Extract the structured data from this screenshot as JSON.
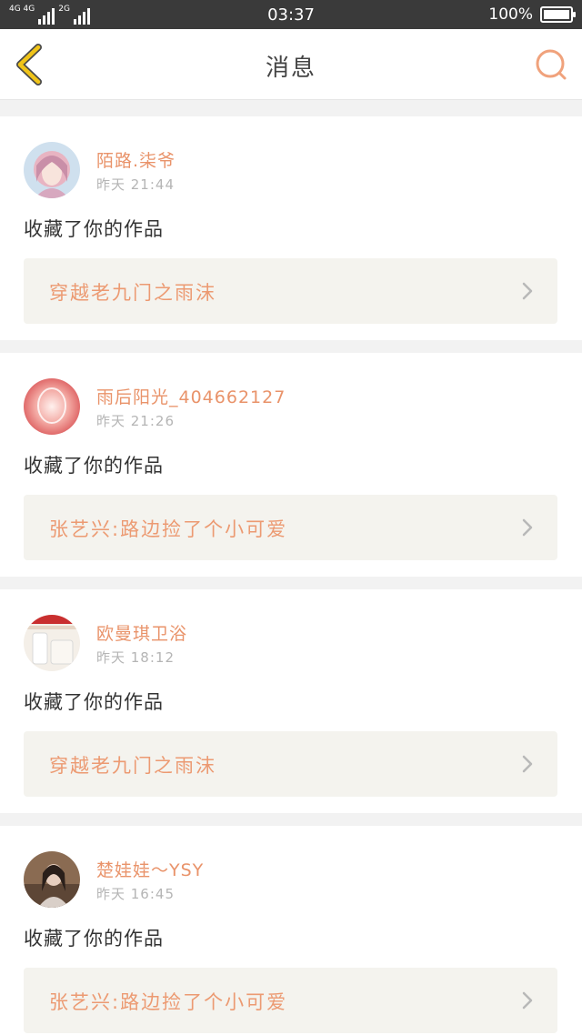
{
  "status_bar": {
    "network_label_1": "4G 4G",
    "network_label_2": "2G",
    "time": "03:37",
    "battery_percent": "100%",
    "battery_level": 1.0
  },
  "header": {
    "title": "消息",
    "back_icon": "chevron-left-icon",
    "search_icon": "search-icon"
  },
  "colors": {
    "accent": "#e9936a",
    "back_icon": "#f0c419",
    "status_bar": "#3a3a3a"
  },
  "messages": [
    {
      "user": "陌路.柒爷",
      "time": "昨天 21:44",
      "text": "收藏了你的作品",
      "work_title": "穿越老九门之雨沫",
      "avatar": "anime-girl-avatar"
    },
    {
      "user": "雨后阳光_404662127",
      "time": "昨天 21:26",
      "text": "收藏了你的作品",
      "work_title": "张艺兴:路边捡了个小可爱",
      "avatar": "pink-glow-avatar"
    },
    {
      "user": "欧曼琪卫浴",
      "time": "昨天 18:12",
      "text": "收藏了你的作品",
      "work_title": "穿越老九门之雨沫",
      "avatar": "bathroom-avatar"
    },
    {
      "user": "楚娃娃～YSY",
      "time": "昨天 16:45",
      "text": "收藏了你的作品",
      "work_title": "张艺兴:路边捡了个小可爱",
      "avatar": "portrait-avatar"
    }
  ]
}
